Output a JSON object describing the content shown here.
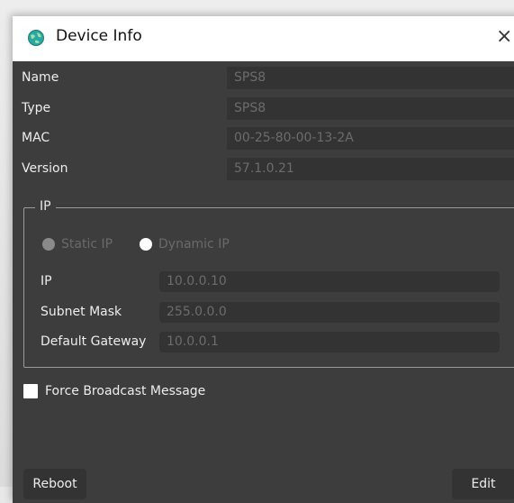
{
  "window": {
    "title": "Device Info",
    "close_glyph": "×",
    "app_icon": "gear-globe-icon",
    "accent_color": "#2aa7a0"
  },
  "fields": [
    {
      "label": "Name",
      "value": "SPS8"
    },
    {
      "label": "Type",
      "value": "SPS8"
    },
    {
      "label": "MAC",
      "value": "00-25-80-00-13-2A"
    },
    {
      "label": "Version",
      "value": "57.1.0.21"
    }
  ],
  "ip_group": {
    "legend": "IP",
    "static_label": "Static IP",
    "dynamic_label": "Dynamic IP",
    "selected": "dynamic",
    "rows": [
      {
        "label": "IP",
        "value": "10.0.0.10"
      },
      {
        "label": "Subnet Mask",
        "value": "255.0.0.0"
      },
      {
        "label": "Default Gateway",
        "value": "10.0.0.1"
      }
    ]
  },
  "force_broadcast": {
    "label": "Force Broadcast Message",
    "checked": false
  },
  "buttons": {
    "reboot": "Reboot",
    "edit": "Edit"
  }
}
